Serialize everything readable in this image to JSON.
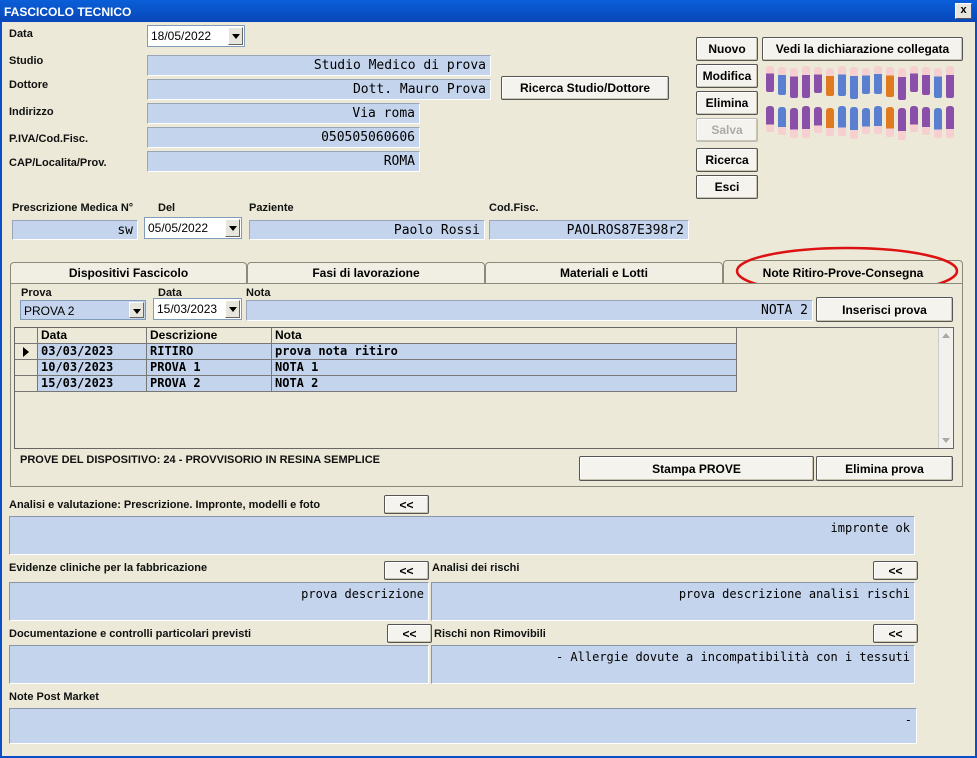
{
  "window": {
    "title": "FASCICOLO TECNICO",
    "close": "x"
  },
  "form": {
    "data_label": "Data",
    "data_value": "18/05/2022",
    "studio_label": "Studio",
    "studio_value": "Studio Medico di prova",
    "dottore_label": "Dottore",
    "dottore_value": "Dott. Mauro Prova",
    "indirizzo_label": "Indirizzo",
    "indirizzo_value": "Via roma",
    "piva_label": "P.IVA/Cod.Fisc.",
    "piva_value": "050505060606",
    "cap_label": "CAP/Localita/Prov.",
    "cap_value": "ROMA",
    "ricerca_studio_button": "Ricerca Studio/Dottore"
  },
  "actions": {
    "nuovo": "Nuovo",
    "modifica": "Modifica",
    "elimina": "Elimina",
    "salva": "Salva",
    "ricerca": "Ricerca",
    "esci": "Esci",
    "vedi_dichiarazione": "Vedi la dichiarazione collegata"
  },
  "prescription": {
    "presc_label": "Prescrizione Medica N°",
    "presc_value": "sw",
    "del_label": "Del",
    "del_value": "05/05/2022",
    "paziente_label": "Paziente",
    "paziente_value": "Paolo Rossi",
    "codfisc_label": "Cod.Fisc.",
    "codfisc_value": "PAOLROS87E398r2"
  },
  "tabs": [
    {
      "label": "Dispositivi Fascicolo"
    },
    {
      "label": "Fasi di lavorazione"
    },
    {
      "label": "Materiali e Lotti"
    },
    {
      "label": "Note Ritiro-Prove-Consegna"
    }
  ],
  "prove": {
    "prova_label": "Prova",
    "prova_value": "PROVA 2",
    "data_label": "Data",
    "data_value": "15/03/2023",
    "nota_label": "Nota",
    "nota_value": "NOTA 2",
    "inserisci_button": "Inserisci prova",
    "columns": [
      "Data",
      "Descrizione",
      "Nota"
    ],
    "rows": [
      {
        "data": "03/03/2023",
        "descrizione": "RITIRO",
        "nota": "prova nota  ritiro"
      },
      {
        "data": "10/03/2023",
        "descrizione": "PROVA 1",
        "nota": "NOTA 1"
      },
      {
        "data": "15/03/2023",
        "descrizione": "PROVA 2",
        "nota": "NOTA 2"
      }
    ],
    "device_caption": "PROVE DEL DISPOSITIVO: 24 - PROVVISORIO IN RESINA SEMPLICE",
    "stampa_button": "Stampa PROVE",
    "elimina_button": "Elimina prova"
  },
  "sections": {
    "analisi_label": "Analisi e valutazione: Prescrizione. Impronte, modelli e foto",
    "analisi_value": "impronte ok",
    "evidenze_label": "Evidenze cliniche per la fabbricazione",
    "evidenze_value": "prova descrizione",
    "rischi_label": "Analisi dei rischi",
    "rischi_value": "prova descrizione analisi rischi",
    "documentazione_label": "Documentazione e controlli particolari previsti",
    "documentazione_value": "",
    "rischi_non_label": "Rischi non Rimovibili",
    "rischi_non_value": "- Allergie dovute a incompatibilità con i tessuti",
    "note_post_label": "Note Post Market",
    "note_post_value": "-",
    "expand_label": "<<"
  }
}
